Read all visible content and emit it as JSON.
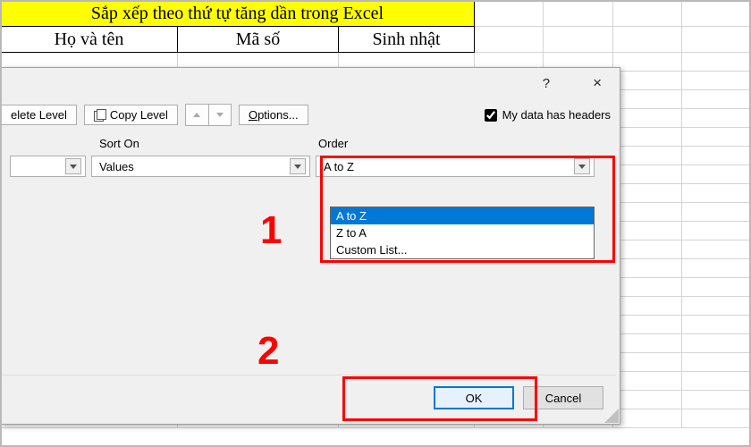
{
  "sheet": {
    "title": "Sắp xếp theo thứ tự tăng dần trong Excel",
    "headers": [
      "Họ và tên",
      "Mã số",
      "Sinh nhật"
    ]
  },
  "dialog": {
    "help_symbol": "?",
    "close_symbol": "×",
    "toolbar": {
      "delete_level": "elete Level",
      "copy_level": "Copy Level",
      "options": "Options...",
      "headers_checkbox": "My data has headers"
    },
    "columns": {
      "sort_on_label": "Sort On",
      "order_label": "Order"
    },
    "values": {
      "sort_on": "Values",
      "order": "A to Z"
    },
    "order_options": [
      "A to Z",
      "Z to A",
      "Custom List..."
    ],
    "footer": {
      "ok": "OK",
      "cancel": "Cancel"
    }
  },
  "annotations": {
    "one": "1",
    "two": "2"
  }
}
